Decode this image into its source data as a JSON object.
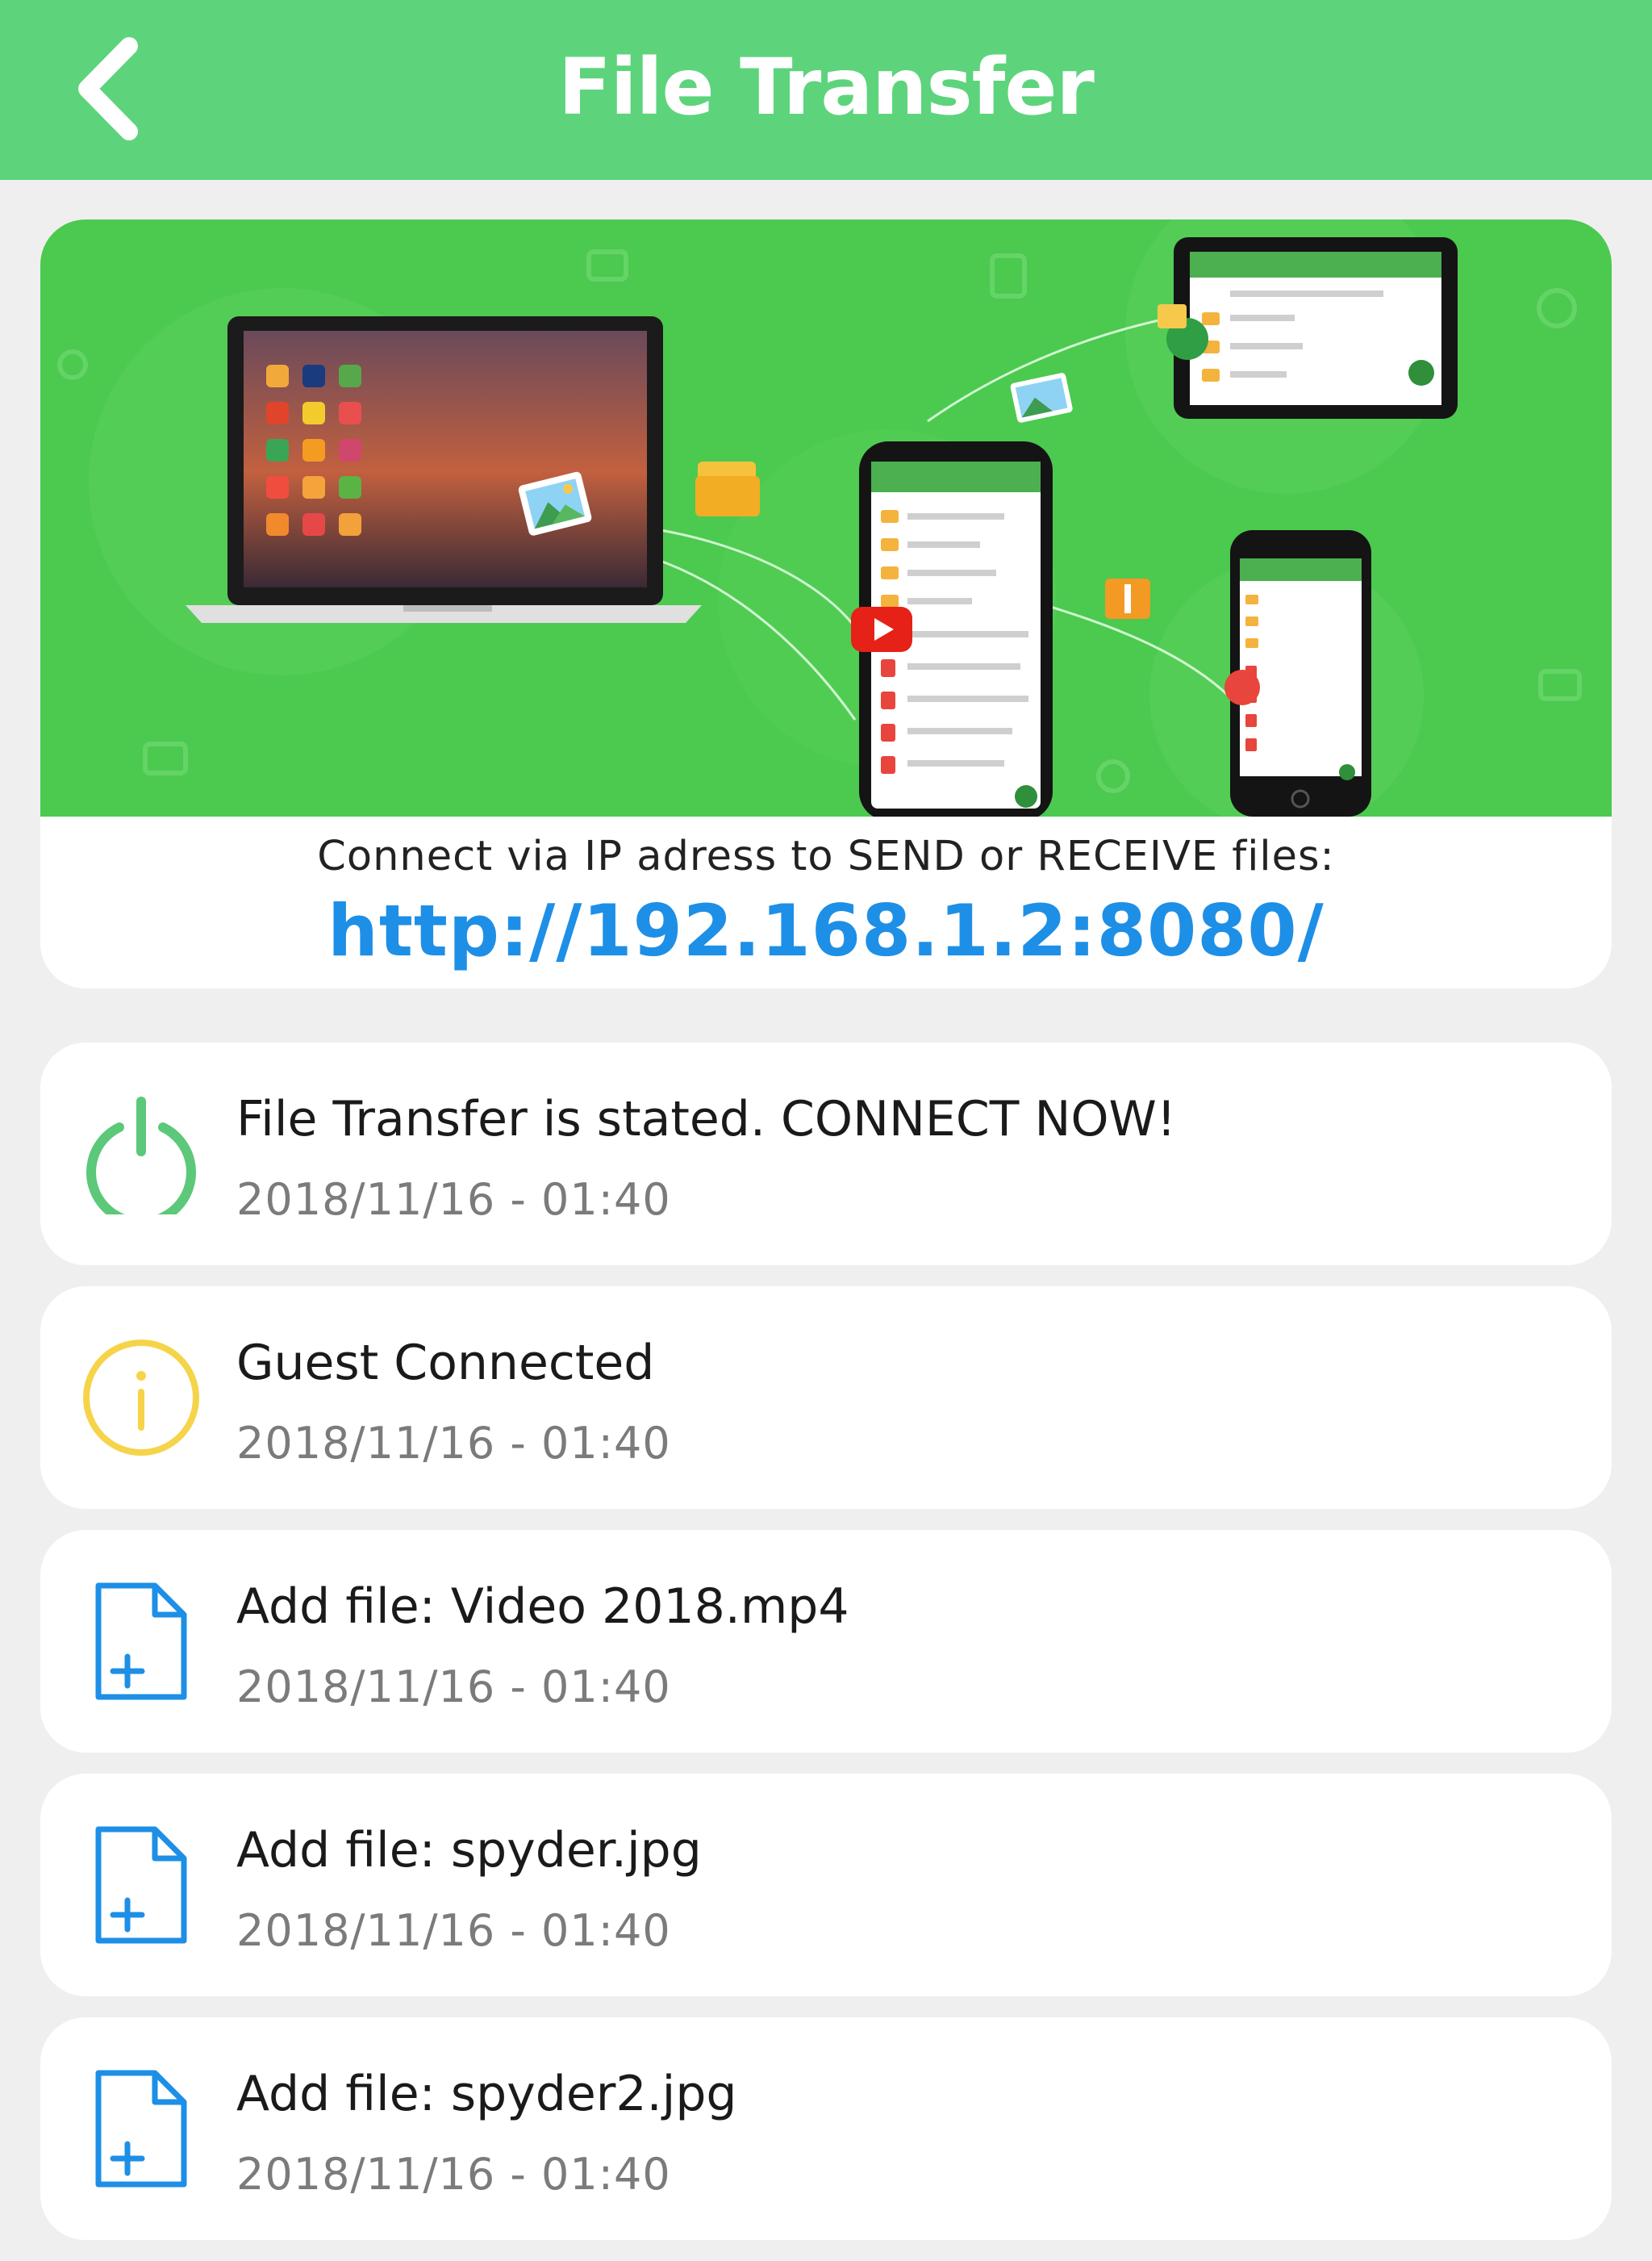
{
  "header": {
    "title": "File Transfer",
    "back_icon": "chevron-left-icon"
  },
  "banner": {
    "caption": "Connect via IP adress to SEND or RECEIVE files:",
    "url": "http://192.168.1.2:8080/"
  },
  "colors": {
    "nav": "#5dd47c",
    "banner_bg": "#4cc94f",
    "url": "#1e8fe6",
    "power": "#5cc879",
    "info": "#f5d44a",
    "file": "#1e8fe6"
  },
  "log": [
    {
      "icon": "power-icon",
      "title": "File Transfer is stated. CONNECT NOW!",
      "time": "2018/11/16 - 01:40"
    },
    {
      "icon": "info-icon",
      "title": "Guest Connected",
      "time": "2018/11/16 - 01:40"
    },
    {
      "icon": "add-file-icon",
      "title": "Add file: Video 2018.mp4",
      "time": "2018/11/16 - 01:40"
    },
    {
      "icon": "add-file-icon",
      "title": "Add file: spyder.jpg",
      "time": "2018/11/16 - 01:40"
    },
    {
      "icon": "add-file-icon",
      "title": "Add file: spyder2.jpg",
      "time": "2018/11/16 - 01:40"
    }
  ]
}
